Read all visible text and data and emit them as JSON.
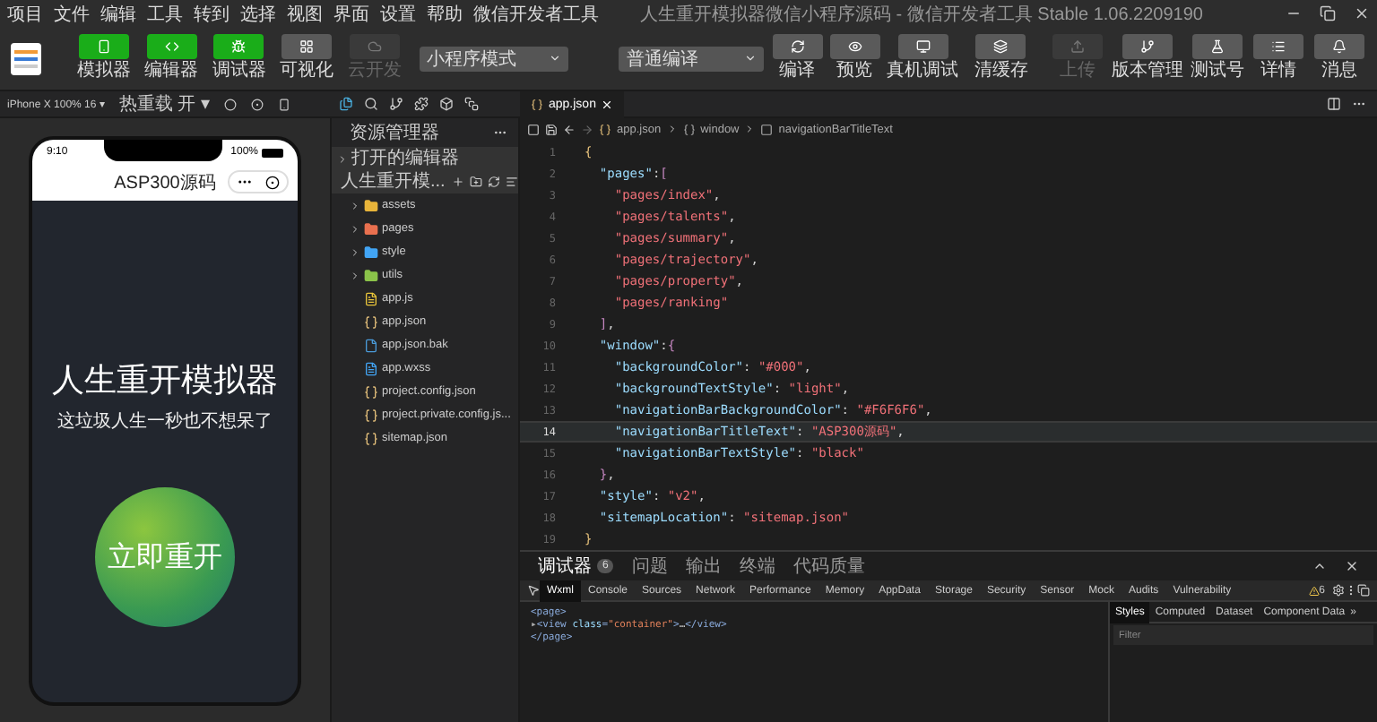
{
  "menu": [
    "项目",
    "文件",
    "编辑",
    "工具",
    "转到",
    "选择",
    "视图",
    "界面",
    "设置",
    "帮助",
    "微信开发者工具"
  ],
  "window": {
    "title": "人生重开模拟器微信小程序源码 - 微信开发者工具 Stable 1.06.2209190"
  },
  "toolbar": {
    "view_buttons": [
      {
        "label": "模拟器",
        "kind": "phone",
        "on": true,
        "disabled": false
      },
      {
        "label": "编辑器",
        "kind": "code",
        "on": true,
        "disabled": false
      },
      {
        "label": "调试器",
        "kind": "debug",
        "on": true,
        "disabled": false
      },
      {
        "label": "可视化",
        "kind": "visual",
        "on": false,
        "disabled": false
      },
      {
        "label": "云开发",
        "kind": "cloud",
        "on": false,
        "disabled": true
      }
    ],
    "mode_select": "小程序模式",
    "compile_select": "普通编译",
    "compile_actions": [
      {
        "label": "编译",
        "kind": "refresh"
      },
      {
        "label": "预览",
        "kind": "eye"
      },
      {
        "label": "真机调试",
        "kind": "device"
      },
      {
        "label": "清缓存",
        "kind": "layers"
      }
    ],
    "right_actions": [
      {
        "label": "上传",
        "kind": "upload",
        "disabled": true
      },
      {
        "label": "版本管理",
        "kind": "branch",
        "disabled": false
      },
      {
        "label": "测试号",
        "kind": "test",
        "disabled": false
      },
      {
        "label": "详情",
        "kind": "list",
        "disabled": false
      },
      {
        "label": "消息",
        "kind": "bell",
        "disabled": false
      }
    ]
  },
  "simulator": {
    "device": "iPhone X 100% 16 ▾",
    "hot_reload": "热重载 开 ▾",
    "phone": {
      "time": "9:10",
      "battery": "100%",
      "nav_title": "ASP300源码",
      "title": "人生重开模拟器",
      "subtitle": "这垃圾人生一秒也不想呆了",
      "button": "立即重开"
    }
  },
  "explorer": {
    "title": "资源管理器",
    "sections": [
      {
        "label": "打开的编辑器",
        "expanded": false
      },
      {
        "label": "人生重开模...",
        "expanded": true,
        "children": [
          {
            "name": "assets",
            "kind": "folder",
            "color": "#e8b43a",
            "expanded": false
          },
          {
            "name": "pages",
            "kind": "folder",
            "color": "#e9704f",
            "expanded": false
          },
          {
            "name": "style",
            "kind": "folder",
            "color": "#42a5f5",
            "expanded": false
          },
          {
            "name": "utils",
            "kind": "folder",
            "color": "#8bc34a",
            "expanded": false
          },
          {
            "name": "app.js",
            "kind": "js"
          },
          {
            "name": "app.json",
            "kind": "json"
          },
          {
            "name": "app.json.bak",
            "kind": "file"
          },
          {
            "name": "app.wxss",
            "kind": "style"
          },
          {
            "name": "project.config.json",
            "kind": "json"
          },
          {
            "name": "project.private.config.js...",
            "kind": "json"
          },
          {
            "name": "sitemap.json",
            "kind": "json"
          }
        ]
      }
    ]
  },
  "editor": {
    "tabs": [
      {
        "label": "app.json",
        "selected": true
      }
    ],
    "breadcrumb": [
      {
        "label": "app.json",
        "kind": "json"
      },
      {
        "label": "window",
        "kind": "object"
      },
      {
        "label": "navigationBarTitleText",
        "kind": "field"
      }
    ],
    "lines": [
      {
        "number": "1",
        "current": false,
        "tokens": [
          {
            "kind": "brace",
            "text": "{"
          }
        ]
      },
      {
        "number": "2",
        "current": false,
        "tokens": [
          {
            "kind": "key",
            "text": "  \"pages\""
          },
          {
            "kind": "punct",
            "text": ":"
          },
          {
            "kind": "bracket",
            "text": "["
          }
        ]
      },
      {
        "number": "3",
        "current": false,
        "tokens": [
          {
            "kind": "string",
            "text": "    \"pages/index\""
          },
          {
            "kind": "punct",
            "text": ","
          }
        ]
      },
      {
        "number": "4",
        "current": false,
        "tokens": [
          {
            "kind": "string",
            "text": "    \"pages/talents\""
          },
          {
            "kind": "punct",
            "text": ","
          }
        ]
      },
      {
        "number": "5",
        "current": false,
        "tokens": [
          {
            "kind": "string",
            "text": "    \"pages/summary\""
          },
          {
            "kind": "punct",
            "text": ","
          }
        ]
      },
      {
        "number": "6",
        "current": false,
        "tokens": [
          {
            "kind": "string",
            "text": "    \"pages/trajectory\""
          },
          {
            "kind": "punct",
            "text": ","
          }
        ]
      },
      {
        "number": "7",
        "current": false,
        "tokens": [
          {
            "kind": "string",
            "text": "    \"pages/property\""
          },
          {
            "kind": "punct",
            "text": ","
          }
        ]
      },
      {
        "number": "8",
        "current": false,
        "tokens": [
          {
            "kind": "string",
            "text": "    \"pages/ranking\""
          }
        ]
      },
      {
        "number": "9",
        "current": false,
        "tokens": [
          {
            "kind": "bracket",
            "text": "  ]"
          },
          {
            "kind": "punct",
            "text": ","
          }
        ]
      },
      {
        "number": "10",
        "current": false,
        "tokens": [
          {
            "kind": "key",
            "text": "  \"window\""
          },
          {
            "kind": "punct",
            "text": ":"
          },
          {
            "kind": "bracket",
            "text": "{"
          }
        ]
      },
      {
        "number": "11",
        "current": false,
        "tokens": [
          {
            "kind": "key",
            "text": "    \"backgroundColor\""
          },
          {
            "kind": "punct",
            "text": ": "
          },
          {
            "kind": "string",
            "text": "\"#000\""
          },
          {
            "kind": "punct",
            "text": ","
          }
        ]
      },
      {
        "number": "12",
        "current": false,
        "tokens": [
          {
            "kind": "key",
            "text": "    \"backgroundTextStyle\""
          },
          {
            "kind": "punct",
            "text": ": "
          },
          {
            "kind": "string",
            "text": "\"light\""
          },
          {
            "kind": "punct",
            "text": ","
          }
        ]
      },
      {
        "number": "13",
        "current": false,
        "tokens": [
          {
            "kind": "key",
            "text": "    \"navigationBarBackgroundColor\""
          },
          {
            "kind": "punct",
            "text": ": "
          },
          {
            "kind": "string",
            "text": "\"#F6F6F6\""
          },
          {
            "kind": "punct",
            "text": ","
          }
        ]
      },
      {
        "number": "14",
        "current": true,
        "tokens": [
          {
            "kind": "key",
            "text": "    \"navigationBarTitleText\""
          },
          {
            "kind": "punct",
            "text": ": "
          },
          {
            "kind": "string",
            "text": "\"ASP300源码\""
          },
          {
            "kind": "punct",
            "text": ","
          }
        ]
      },
      {
        "number": "15",
        "current": false,
        "tokens": [
          {
            "kind": "key",
            "text": "    \"navigationBarTextStyle\""
          },
          {
            "kind": "punct",
            "text": ": "
          },
          {
            "kind": "string",
            "text": "\"black\""
          }
        ]
      },
      {
        "number": "16",
        "current": false,
        "tokens": [
          {
            "kind": "bracket",
            "text": "  }"
          },
          {
            "kind": "punct",
            "text": ","
          }
        ]
      },
      {
        "number": "17",
        "current": false,
        "tokens": [
          {
            "kind": "key",
            "text": "  \"style\""
          },
          {
            "kind": "punct",
            "text": ": "
          },
          {
            "kind": "string",
            "text": "\"v2\""
          },
          {
            "kind": "punct",
            "text": ","
          }
        ]
      },
      {
        "number": "18",
        "current": false,
        "tokens": [
          {
            "kind": "key",
            "text": "  \"sitemapLocation\""
          },
          {
            "kind": "punct",
            "text": ": "
          },
          {
            "kind": "string",
            "text": "\"sitemap.json\""
          }
        ]
      },
      {
        "number": "19",
        "current": false,
        "tokens": [
          {
            "kind": "brace",
            "text": "}"
          }
        ]
      }
    ]
  },
  "devtools": {
    "panel_tabs": [
      {
        "label": "调试器",
        "badge": "6",
        "selected": true
      },
      {
        "label": "问题",
        "selected": false
      },
      {
        "label": "输出",
        "selected": false
      },
      {
        "label": "终端",
        "selected": false
      },
      {
        "label": "代码质量",
        "selected": false
      }
    ],
    "tabs": [
      {
        "label": "Wxml",
        "selected": true
      },
      {
        "label": "Console",
        "selected": false
      },
      {
        "label": "Sources",
        "selected": false
      },
      {
        "label": "Network",
        "selected": false
      },
      {
        "label": "Performance",
        "selected": false
      },
      {
        "label": "Memory",
        "selected": false
      },
      {
        "label": "AppData",
        "selected": false
      },
      {
        "label": "Storage",
        "selected": false
      },
      {
        "label": "Security",
        "selected": false
      },
      {
        "label": "Sensor",
        "selected": false
      },
      {
        "label": "Mock",
        "selected": false
      },
      {
        "label": "Audits",
        "selected": false
      },
      {
        "label": "Vulnerability",
        "selected": false
      }
    ],
    "warnings": "6",
    "dom": [
      {
        "tokens": [
          {
            "kind": "tag",
            "text": "<page>"
          }
        ]
      },
      {
        "tokens": [
          {
            "kind": "arrow",
            "text": "▸"
          },
          {
            "kind": "tag",
            "text": "<view "
          },
          {
            "kind": "attr",
            "text": "class"
          },
          {
            "kind": "tag",
            "text": "="
          },
          {
            "kind": "value",
            "text": "\"container\""
          },
          {
            "kind": "tag",
            "text": ">"
          },
          {
            "kind": "text",
            "text": "…"
          },
          {
            "kind": "tag",
            "text": "</view>"
          }
        ]
      },
      {
        "tokens": [
          {
            "kind": "tag",
            "text": "</page>"
          }
        ]
      }
    ],
    "side_tabs": [
      {
        "label": "Styles",
        "selected": true
      },
      {
        "label": "Computed",
        "selected": false
      },
      {
        "label": "Dataset",
        "selected": false
      },
      {
        "label": "Component Data",
        "selected": false
      }
    ],
    "side_more": "»",
    "filter": {
      "placeholder": "Filter"
    }
  }
}
